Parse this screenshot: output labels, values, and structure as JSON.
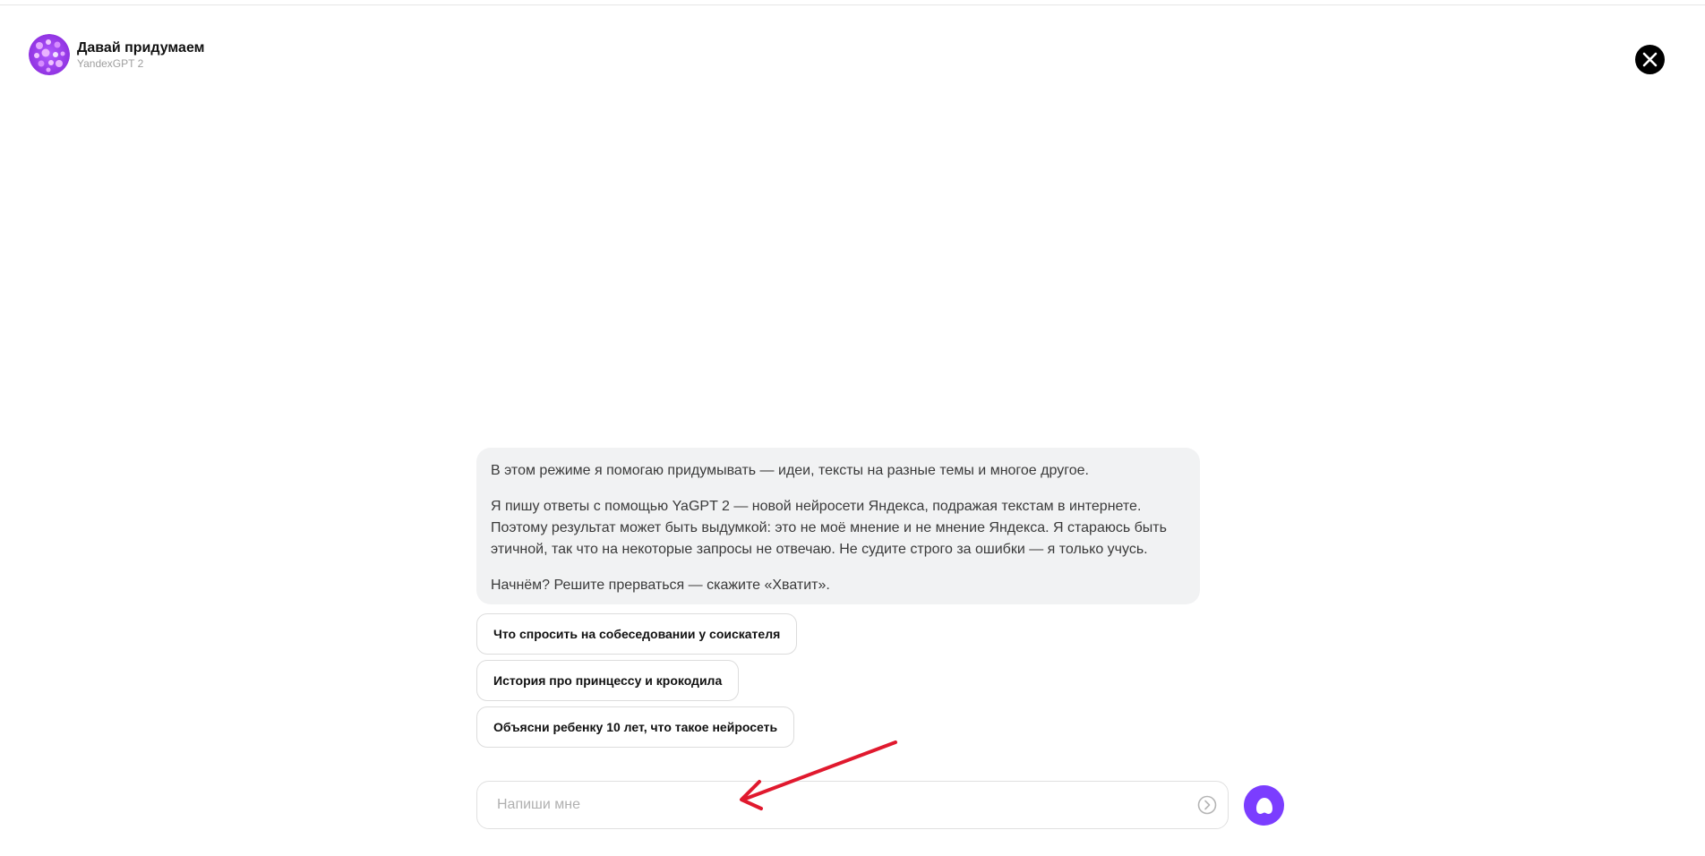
{
  "header": {
    "title": "Давай придумаем",
    "subtitle": "YandexGPT 2",
    "avatar_icon": "bubbles-avatar-icon",
    "close_icon": "close-icon"
  },
  "message": {
    "paragraphs": [
      "В этом режиме я помогаю придумывать — идеи, тексты на разные темы и многое другое.",
      "Я пишу ответы с помощью YaGPT 2 — новой нейросети Яндекса, подражая текстам в интернете. Поэтому результат может быть выдумкой: это не моё мнение и не мнение Яндекса. Я стараюсь быть этичной, так что на некоторые запросы не отвечаю. Не судите строго за ошибки — я только учусь.",
      "Начнём? Решите прерваться — скажите «Хватит»."
    ]
  },
  "suggestions": [
    "Что спросить на собеседовании у соискателя",
    "История про принцессу и крокодила",
    "Объясни ребенку 10 лет, что такое нейросеть"
  ],
  "input": {
    "placeholder": "Напиши мне",
    "value": "",
    "send_icon": "send-arrow-icon"
  },
  "alice_button": {
    "icon": "alice-icon"
  },
  "colors": {
    "accent": "#7b3dff",
    "bubble_bg": "#f1f2f3",
    "annotation": "#e0192e"
  }
}
